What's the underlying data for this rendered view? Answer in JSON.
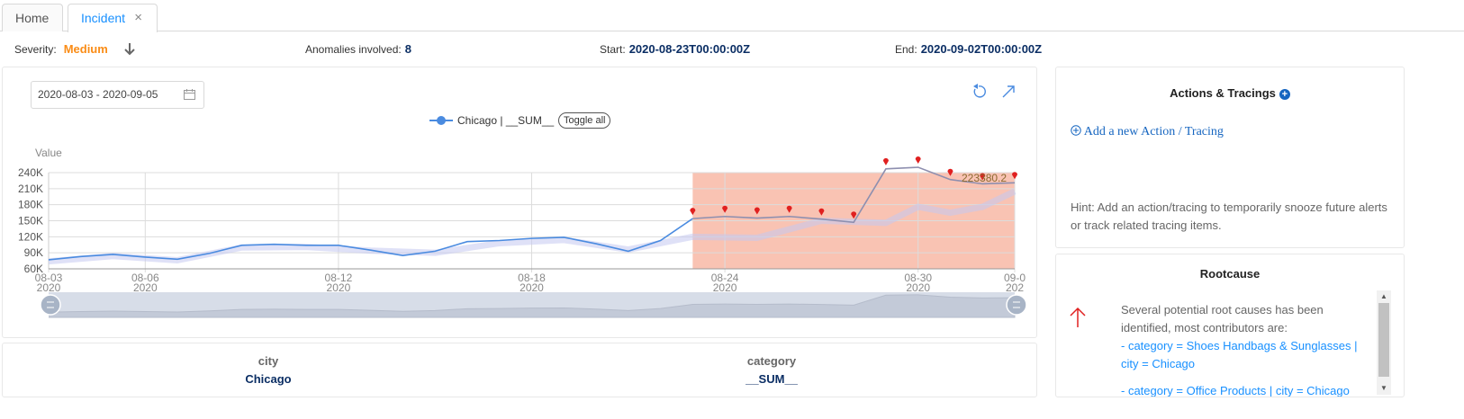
{
  "tabs": [
    {
      "label": "Home"
    },
    {
      "label": "Incident",
      "close": "×"
    }
  ],
  "summary": {
    "severity_label": "Severity:",
    "severity_value": "Medium",
    "anomalies_label": "Anomalies involved:",
    "anomalies_value": "8",
    "start_label": "Start:",
    "start_value": "2020-08-23T00:00:00Z",
    "end_label": "End:",
    "end_value": "2020-09-02T00:00:00Z"
  },
  "chart_panel": {
    "date_range": "2020-08-03 - 2020-09-05",
    "legend_series": "Chicago | __SUM__",
    "toggle_all": "Toggle all",
    "tooltip_value": "223380.2"
  },
  "chart_data": {
    "type": "line",
    "ylabel": "Value",
    "ylim": [
      60000,
      240000
    ],
    "yticks": [
      60000,
      90000,
      120000,
      150000,
      180000,
      210000,
      240000
    ],
    "ytick_labels": [
      "60K",
      "90K",
      "120K",
      "150K",
      "180K",
      "210K",
      "240K"
    ],
    "xticks": [
      {
        "day": 0,
        "label": "08-03",
        "year": "2020"
      },
      {
        "day": 3,
        "label": "08-06",
        "year": "2020"
      },
      {
        "day": 9,
        "label": "08-12",
        "year": "2020"
      },
      {
        "day": 15,
        "label": "08-18",
        "year": "2020"
      },
      {
        "day": 21,
        "label": "08-24",
        "year": "2020"
      },
      {
        "day": 27,
        "label": "08-30",
        "year": "2020"
      },
      {
        "day": 30,
        "label": "09-0",
        "year": "202"
      }
    ],
    "x_range_days": [
      0,
      30
    ],
    "anomaly_region_days": [
      20,
      30
    ],
    "series": [
      {
        "name": "Chicago | __SUM__",
        "color": "#4a8be0",
        "points_days": [
          0,
          1,
          2,
          3,
          4,
          5,
          6,
          7,
          8,
          9,
          10,
          11,
          12,
          13,
          14,
          15,
          16,
          17,
          18,
          19,
          20
        ],
        "values": [
          77000,
          83000,
          87000,
          82000,
          78000,
          89000,
          104000,
          106000,
          104000,
          104000,
          95000,
          85000,
          93000,
          111000,
          113000,
          117000,
          119000,
          107000,
          93000,
          113000,
          154000
        ]
      },
      {
        "name": "Chicago | __SUM__ (anomaly)",
        "color": "#8e8faf",
        "points_days": [
          20,
          21,
          22,
          23,
          24,
          25,
          26,
          27,
          28,
          29,
          30
        ],
        "values": [
          154000,
          158000,
          155000,
          158000,
          153000,
          147000,
          247000,
          250000,
          227000,
          219000,
          221000
        ]
      }
    ],
    "baseline_band": {
      "color": "#c5c9f0",
      "points_days": [
        0,
        2,
        4,
        6,
        8,
        10,
        12,
        14,
        16,
        18,
        19,
        20,
        22,
        24,
        25,
        26,
        27,
        28,
        29,
        30
      ],
      "values": [
        74000,
        84000,
        76000,
        100000,
        101000,
        94000,
        90000,
        108000,
        114000,
        96000,
        108000,
        120000,
        118000,
        150000,
        148000,
        146000,
        176000,
        165000,
        176000,
        205000
      ]
    },
    "anomaly_markers_days": [
      20,
      21,
      22,
      23,
      24,
      25,
      26,
      27,
      28,
      29,
      30
    ],
    "anomaly_marker_values": [
      154000,
      158000,
      155000,
      158000,
      153000,
      147000,
      247000,
      250000,
      227000,
      219000,
      221000
    ]
  },
  "dimensions": [
    {
      "label": "city",
      "value": "Chicago"
    },
    {
      "label": "category",
      "value": "__SUM__"
    }
  ],
  "actions": {
    "title": "Actions & Tracings",
    "add_link": "Add a new Action / Tracing",
    "hint": "Hint: Add an action/tracing to temporarily snooze future alerts or track related tracing items."
  },
  "rootcause": {
    "title": "Rootcause",
    "intro": "Several potential root causes has been identified, most contributors are:",
    "items": [
      "- category = Shoes Handbags & Sunglasses | city = Chicago",
      "- category = Office Products | city = Chicago"
    ]
  },
  "colors": {
    "accent": "#1890ff",
    "severity": "#fa8c16",
    "anomaly_region": "#f9c3b3",
    "marker": "#e02020",
    "navy": "#0b2e64"
  }
}
